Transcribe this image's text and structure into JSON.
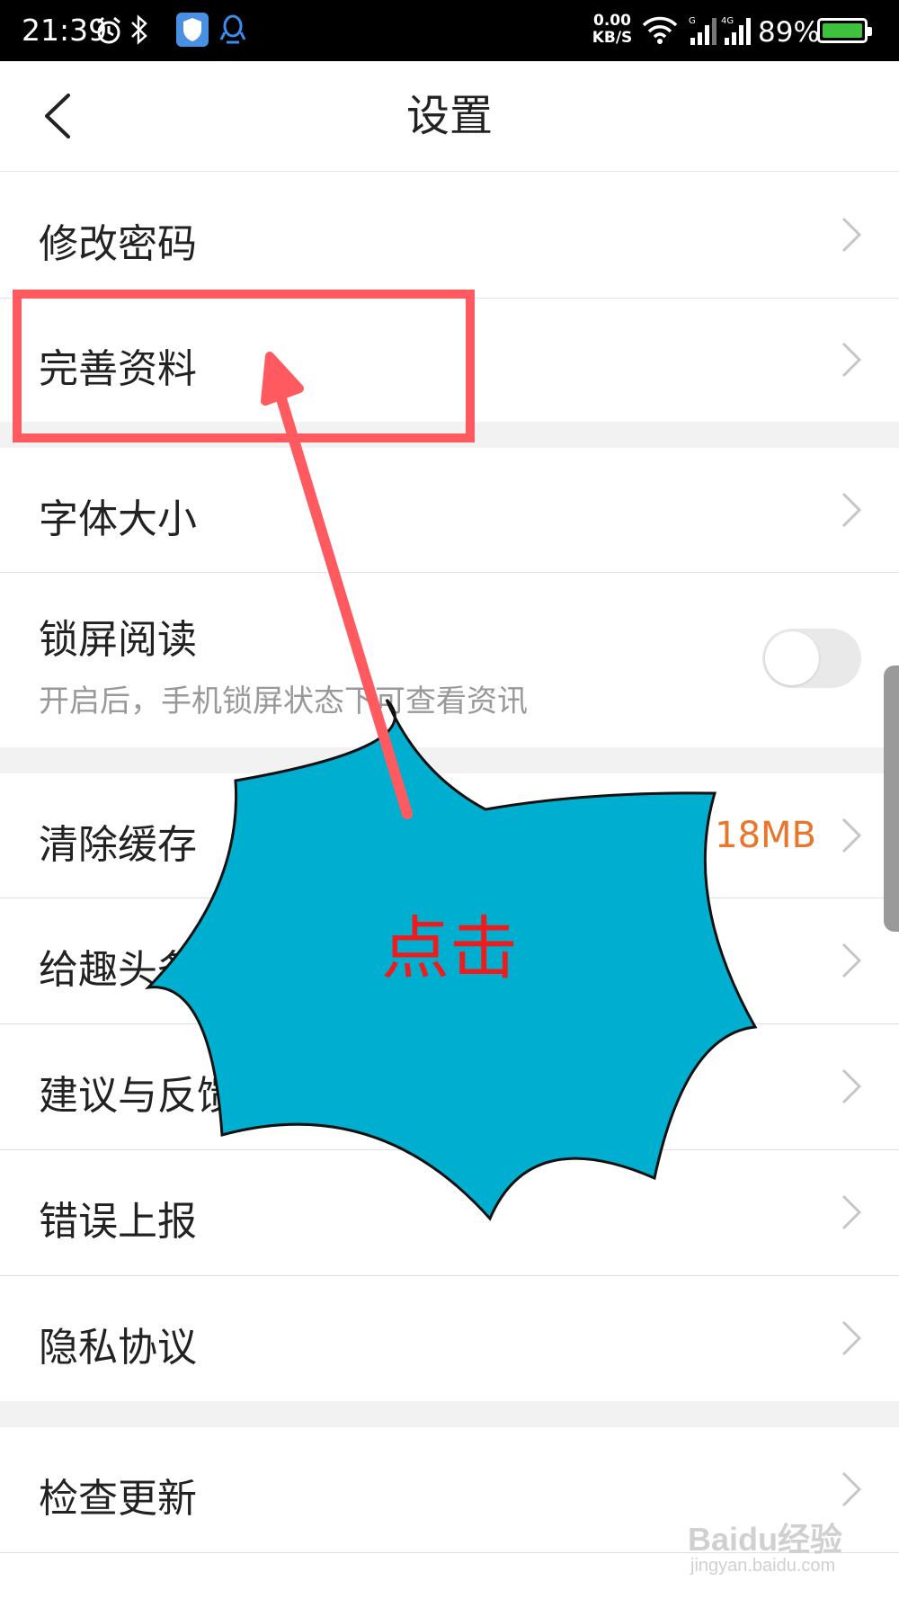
{
  "status_bar": {
    "time": "21:39",
    "net_speed_value": "0.00",
    "net_speed_unit": "KB/S",
    "battery_percent": "89%",
    "icons": [
      "alarm-icon",
      "bluetooth-icon",
      "shield-icon",
      "qq-icon",
      "wifi-icon",
      "signal-icon",
      "signal-4g-icon",
      "battery-icon"
    ]
  },
  "header": {
    "title": "设置",
    "back_icon": "chevron-left-icon"
  },
  "settings": {
    "change_password": "修改密码",
    "complete_profile": "完善资料",
    "font_size": "字体大小",
    "lock_screen_reading": "锁屏阅读",
    "lock_screen_desc": "开启后，手机锁屏状态下可查看资讯",
    "lock_screen_enabled": false,
    "clear_cache": "清除缓存",
    "cache_size": "18MB",
    "rate_app": "给趣头条",
    "feedback": "建议与反馈",
    "error_report": "错误上报",
    "privacy": "隐私协议",
    "check_update": "检查更新"
  },
  "annotation": {
    "click_text": "点击",
    "highlight_color": "#ff5a5f",
    "burst_color": "#00aecf",
    "text_color": "#ee1c1c"
  },
  "watermark": {
    "brand": "Baidu经验",
    "url": "jingyan.baidu.com"
  },
  "colors": {
    "accent_orange": "#e8762b",
    "toggle_off": "#e9e9e9"
  }
}
